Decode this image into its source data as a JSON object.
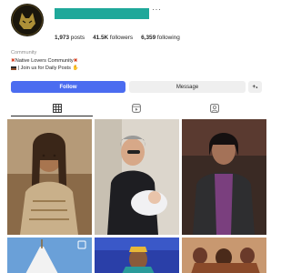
{
  "profile": {
    "posts": "1,973",
    "posts_label": "posts",
    "followers": "41.5K",
    "followers_label": "followers",
    "following": "6,359",
    "following_label": "following",
    "more_glyph": "···",
    "category": "Community",
    "bio_line1": "Native Lovers Community",
    "bio_line2": "| Join us for Daily Posts"
  },
  "actions": {
    "follow_label": "Follow",
    "message_label": "Message",
    "add_label": "+₁"
  },
  "tabs": [
    {
      "name": "posts-grid",
      "icon": "grid-icon",
      "active": true
    },
    {
      "name": "reels",
      "icon": "reels-icon",
      "active": false
    },
    {
      "name": "tagged",
      "icon": "tagged-icon",
      "active": false
    }
  ],
  "colors": {
    "follow_button": "#4b6cf0",
    "name_bar": "#1fa89a"
  }
}
